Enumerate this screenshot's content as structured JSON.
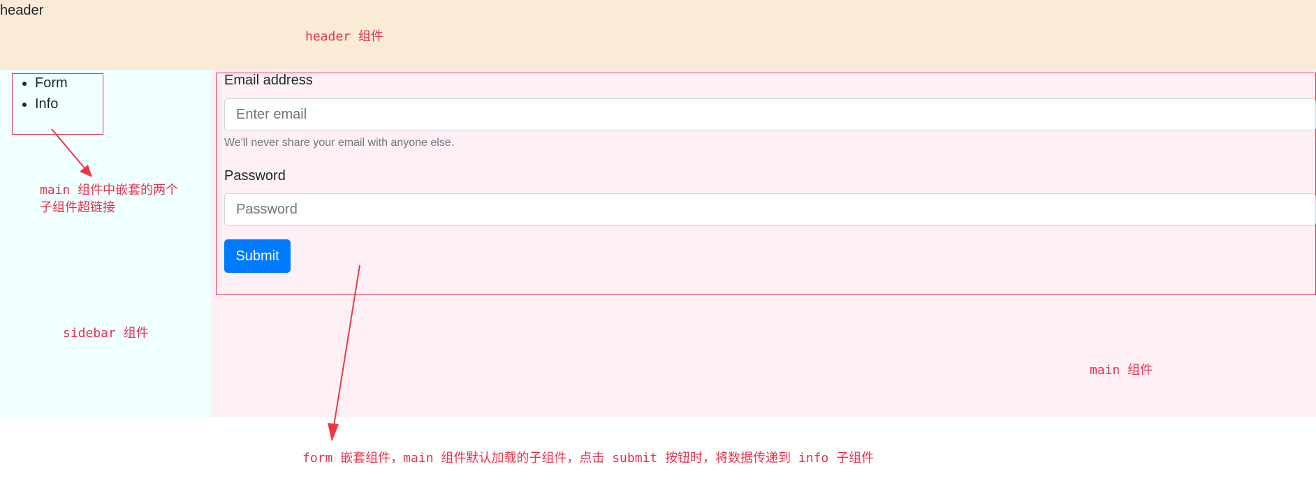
{
  "header": {
    "title": "header"
  },
  "sidebar": {
    "nav_items": [
      {
        "label": "Form"
      },
      {
        "label": "Info"
      }
    ]
  },
  "form": {
    "email_label": "Email address",
    "email_placeholder": "Enter email",
    "email_help": "We'll never share your email with anyone else.",
    "password_label": "Password",
    "password_placeholder": "Password",
    "submit_label": "Submit"
  },
  "annotations": {
    "header_component": "header 组件",
    "sidebar_links_line1": "main 组件中嵌套的两个",
    "sidebar_links_line2": "子组件超链接",
    "sidebar_component": "sidebar 组件",
    "main_component": "main 组件",
    "form_description": "form 嵌套组件，main 组件默认加载的子组件，点击 submit 按钮时，将数据传递到 info 子组件"
  },
  "colors": {
    "header_bg": "#faebd7",
    "sidebar_bg": "#f0ffff",
    "main_bg": "#fff0f5",
    "annotation": "#e8314d",
    "button": "#007bff"
  }
}
